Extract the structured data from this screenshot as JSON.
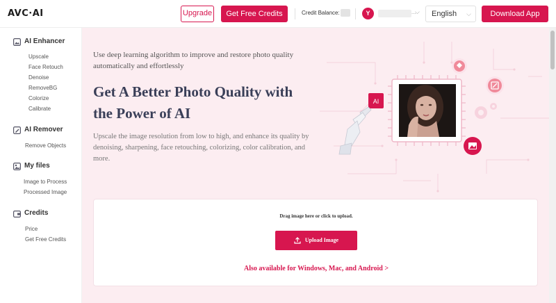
{
  "header": {
    "logo": "AVC·AI",
    "upgrade_label": "Upgrade",
    "free_credits_label": "Get Free Credits",
    "credit_balance_label": "Credit Balance:",
    "avatar_initial": "Y",
    "user_more": "...",
    "language": "English",
    "download_label": "Download App"
  },
  "sidebar": {
    "sections": [
      {
        "title": "AI Enhancer",
        "items": [
          "Upscale",
          "Face Retouch",
          "Denoise",
          "RemoveBG",
          "Colorize",
          "Calibrate"
        ]
      },
      {
        "title": "AI Remover",
        "items": [
          "Remove Objects"
        ]
      },
      {
        "title": "My files",
        "items": [
          "Image to Process",
          "Processed Image"
        ]
      },
      {
        "title": "Credits",
        "items": [
          "Price",
          "Get Free Credits"
        ]
      }
    ]
  },
  "hero": {
    "subtitle": "Use deep learning algorithm to improve and restore photo quality automatically and effortlessly",
    "title": "Get A Better Photo Quality with the Power of AI",
    "description": "Upscale the image resolution from low to high, and enhance its quality by denoising, sharpening, face retouching, colorizing, color calibration, and more.",
    "ai_badge": "AI"
  },
  "upload": {
    "drag_text": "Drag image here or click to upload.",
    "button_label": "Upload Image",
    "also_available": "Also available for Windows, Mac, and Android >"
  },
  "colors": {
    "accent": "#d7164f",
    "main_bg": "#fcedf1",
    "title_text": "#3a3f58"
  }
}
